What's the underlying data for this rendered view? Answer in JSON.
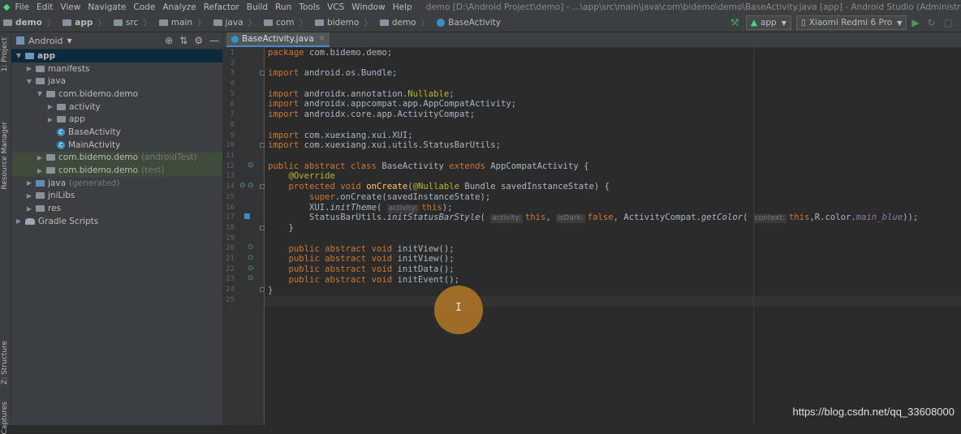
{
  "menubar": {
    "items": [
      "File",
      "Edit",
      "View",
      "Navigate",
      "Code",
      "Analyze",
      "Refactor",
      "Build",
      "Run",
      "Tools",
      "VCS",
      "Window",
      "Help"
    ],
    "window_title": "demo [D:\\Android Project\\demo] - ...\\app\\src\\main\\java\\com\\bidemo\\demo\\BaseActivity.java [app] - Android Studio (Administrator)"
  },
  "breadcrumb": [
    "demo",
    "app",
    "src",
    "main",
    "java",
    "com",
    "bidemo",
    "demo",
    "BaseActivity"
  ],
  "toolbar": {
    "run_config": "app",
    "device": "Xiaomi Redmi 6 Pro"
  },
  "side_tabs": {
    "project": "1: Project",
    "resource_manager": "Resource Manager",
    "structure": "Z: Structure",
    "captures": "Captures"
  },
  "project_panel": {
    "view_mode": "Android",
    "tree": [
      {
        "label": "app",
        "depth": 0,
        "arrow": "▼",
        "icon": "module",
        "selected": true
      },
      {
        "label": "manifests",
        "depth": 1,
        "arrow": "▶",
        "icon": "folder"
      },
      {
        "label": "java",
        "depth": 1,
        "arrow": "▼",
        "icon": "folder"
      },
      {
        "label": "com.bidemo.demo",
        "depth": 2,
        "arrow": "▼",
        "icon": "folder"
      },
      {
        "label": "activity",
        "depth": 3,
        "arrow": "▶",
        "icon": "folder"
      },
      {
        "label": "app",
        "depth": 3,
        "arrow": "▶",
        "icon": "folder"
      },
      {
        "label": "BaseActivity",
        "depth": 3,
        "arrow": "",
        "icon": "class"
      },
      {
        "label": "MainActivity",
        "depth": 3,
        "arrow": "",
        "icon": "class"
      },
      {
        "label": "com.bidemo.demo",
        "depth": 2,
        "arrow": "▶",
        "icon": "folder",
        "suffix": "(androidTest)",
        "hl": true
      },
      {
        "label": "com.bidemo.demo",
        "depth": 2,
        "arrow": "▶",
        "icon": "folder",
        "suffix": "(test)",
        "hl": true
      },
      {
        "label": "java",
        "depth": 1,
        "arrow": "▶",
        "icon": "src",
        "suffix": "(generated)"
      },
      {
        "label": "jniLibs",
        "depth": 1,
        "arrow": "▶",
        "icon": "folder"
      },
      {
        "label": "res",
        "depth": 1,
        "arrow": "▶",
        "icon": "folder"
      },
      {
        "label": "Gradle Scripts",
        "depth": 0,
        "arrow": "▶",
        "icon": "gradle"
      }
    ]
  },
  "editor": {
    "tab_label": "BaseActivity.java",
    "line_numbers": [
      "1",
      "2",
      "3",
      "4",
      "5",
      "6",
      "7",
      "8",
      "9",
      "10",
      "11",
      "12",
      "13",
      "14",
      "15",
      "16",
      "17",
      "18",
      "19",
      "20",
      "21",
      "22",
      "23",
      "24",
      "25"
    ]
  },
  "watermark": "https://blog.csdn.net/qq_33608000"
}
